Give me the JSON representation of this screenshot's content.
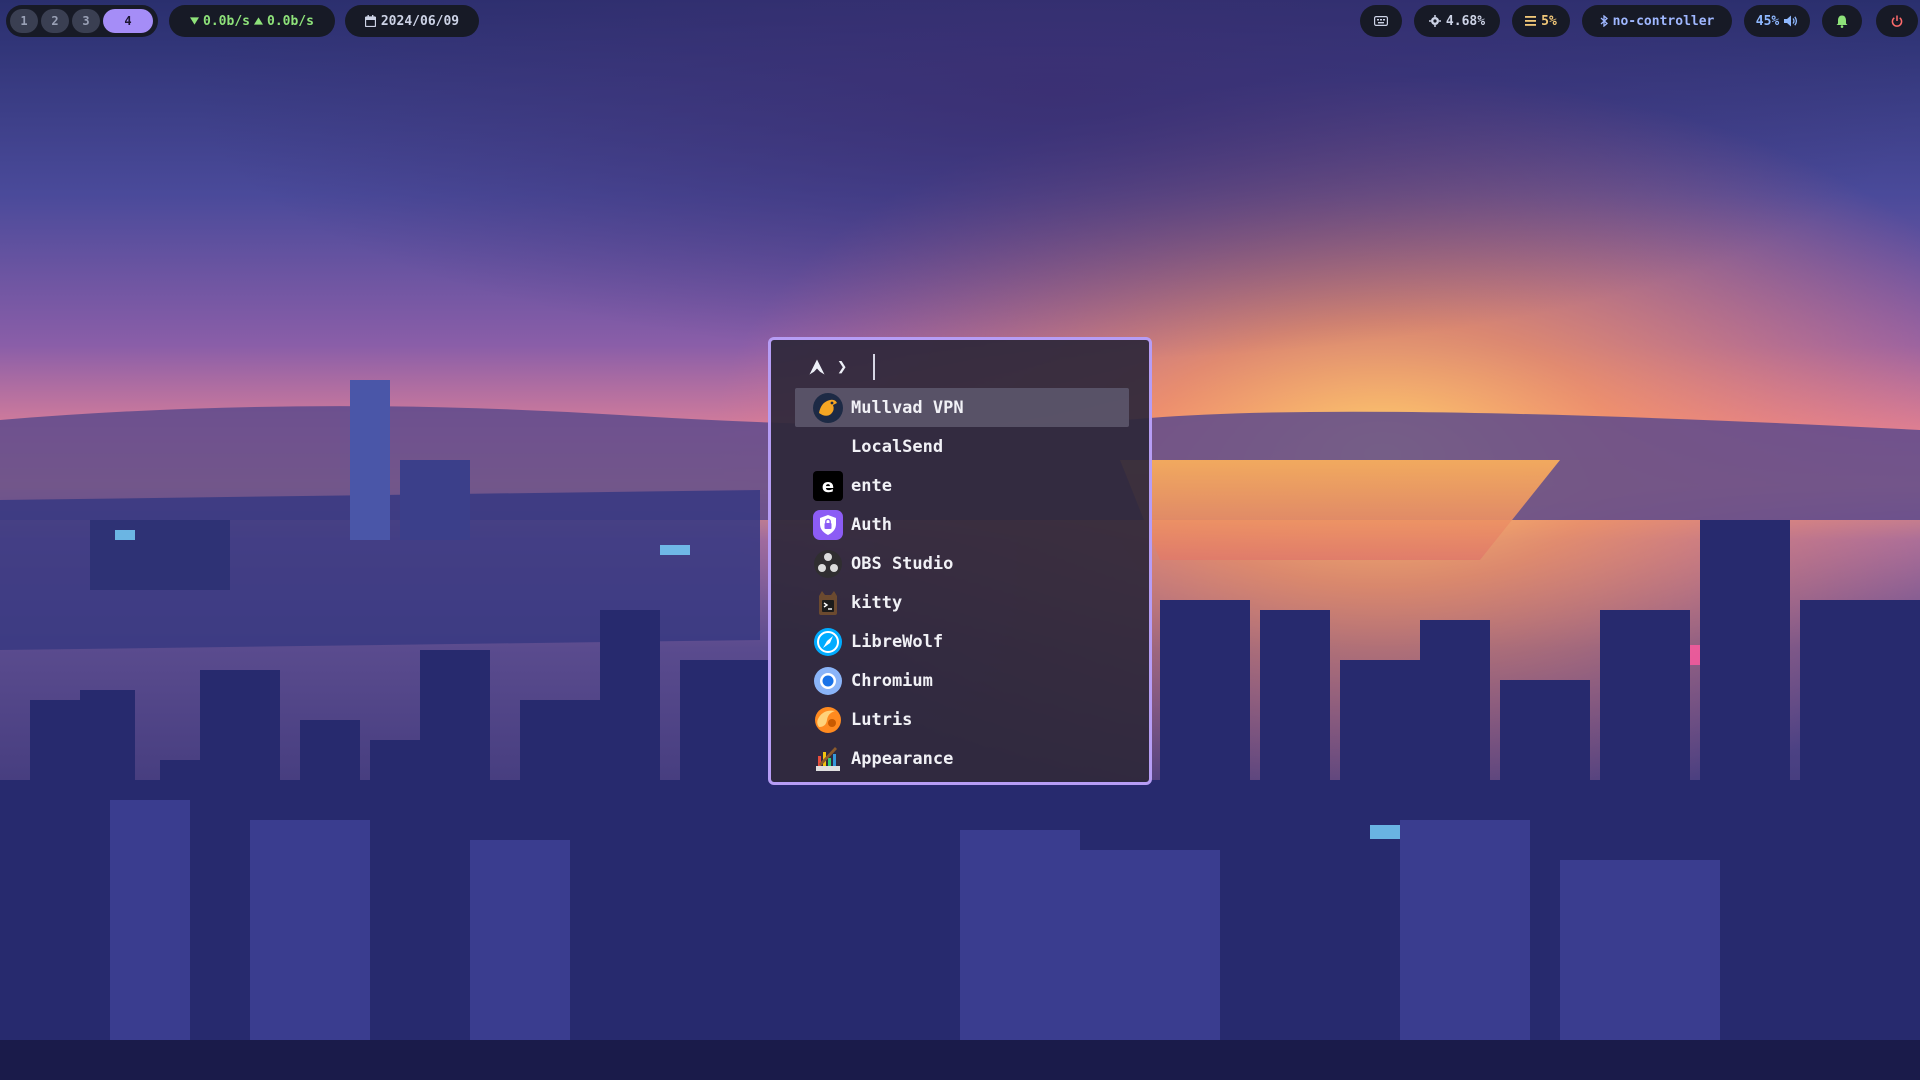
{
  "workspaces": [
    "1",
    "2",
    "3",
    "4"
  ],
  "active_workspace": "4",
  "network": {
    "down": "0.0b/s",
    "up": "0.0b/s"
  },
  "date": "2024/06/09",
  "status": {
    "cpu": "4.68%",
    "memory": "5%",
    "bluetooth": "no-controller",
    "volume": "45%"
  },
  "launcher": {
    "prompt_symbol": "❯",
    "query": "",
    "selected_index": 0,
    "items": [
      {
        "label": "Mullvad VPN",
        "icon": "mullvad-icon"
      },
      {
        "label": "LocalSend",
        "icon": ""
      },
      {
        "label": "ente",
        "icon": "ente-icon"
      },
      {
        "label": "Auth",
        "icon": "auth-icon"
      },
      {
        "label": "OBS Studio",
        "icon": "obs-icon"
      },
      {
        "label": "kitty",
        "icon": "kitty-icon"
      },
      {
        "label": "LibreWolf",
        "icon": "librewolf-icon"
      },
      {
        "label": "Chromium",
        "icon": "chromium-icon"
      },
      {
        "label": "Lutris",
        "icon": "lutris-icon"
      },
      {
        "label": "Appearance",
        "icon": "appearance-icon"
      }
    ]
  },
  "colors": {
    "accent": "#a58df7",
    "launcher_border": "#b69df5",
    "net": "#8ee27a",
    "memory": "#f2c879",
    "power": "#ff6b6b"
  }
}
